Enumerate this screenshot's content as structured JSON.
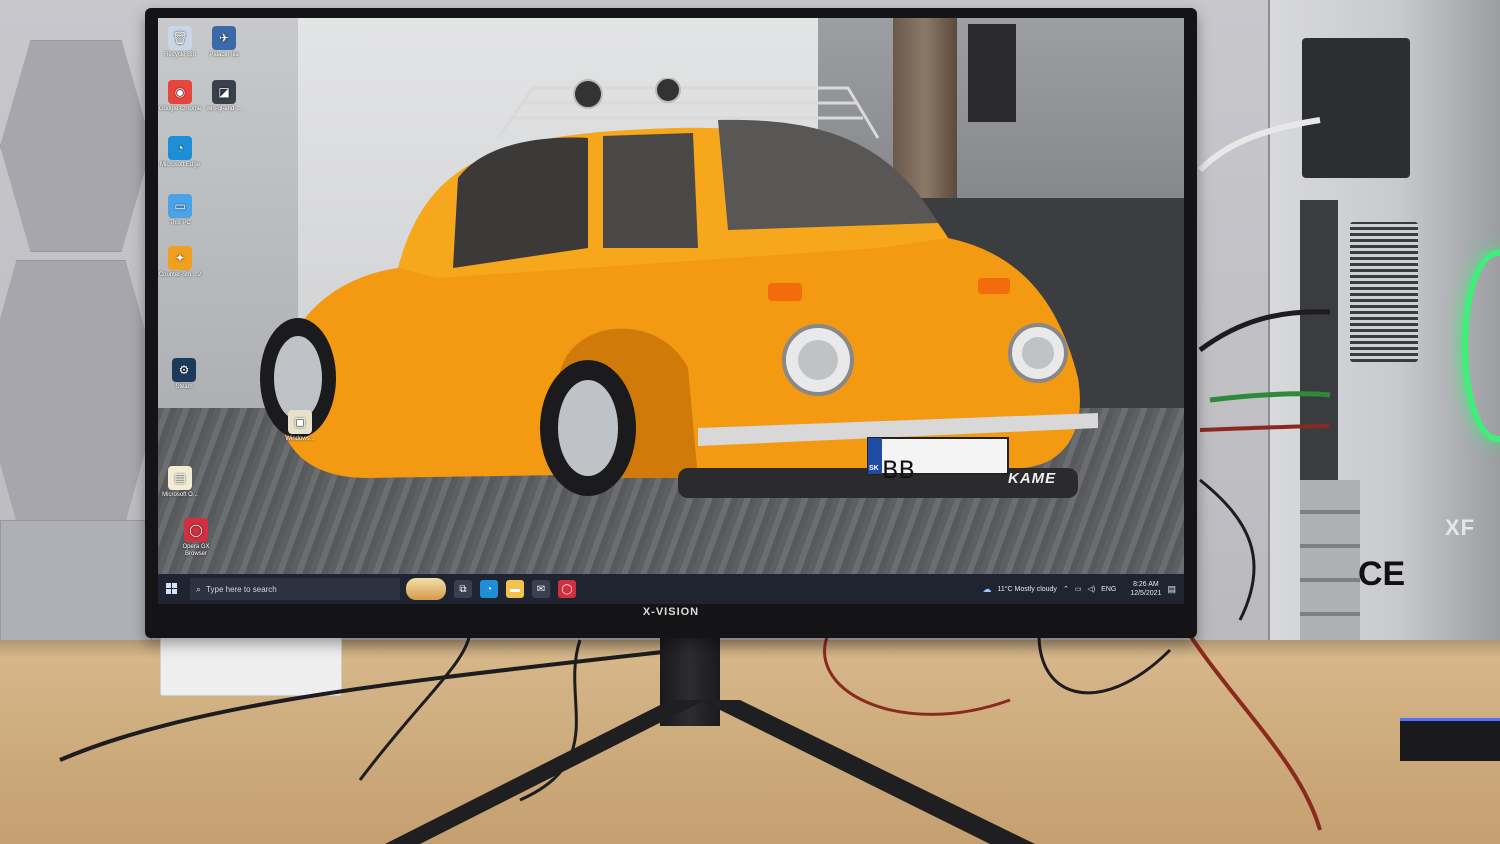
{
  "monitor": {
    "brand": "X-VISION"
  },
  "desktop": {
    "icons": [
      {
        "label": "Recycle Bin",
        "glyph": "🗑",
        "color": "#c9d6e6"
      },
      {
        "label": "Paladin Ilia",
        "glyph": "✈",
        "color": "#3b6aa8"
      },
      {
        "label": "Google Chrome",
        "glyph": "◉",
        "color": "#e8453c"
      },
      {
        "label": "win-gl-and-...",
        "glyph": "◪",
        "color": "#39404d"
      },
      {
        "label": "Microsoft Edge",
        "glyph": "◔",
        "color": "#1e8fd6"
      },
      {
        "label": "This PC",
        "glyph": "▭",
        "color": "#4aa3e8"
      },
      {
        "label": "Counter-Stri... 2",
        "glyph": "✦",
        "color": "#f0a020"
      },
      {
        "label": "Steam",
        "glyph": "⚙",
        "color": "#1b3a5c"
      },
      {
        "label": "Windows...",
        "glyph": "▣",
        "color": "#e8e2c8"
      },
      {
        "label": "Microsoft O...",
        "glyph": "▤",
        "color": "#f2ecd4"
      },
      {
        "label": "Opera GX Browser",
        "glyph": "◯",
        "color": "#d0303f"
      }
    ]
  },
  "wallpaper": {
    "plate": "BB",
    "plate_prefix": "SK",
    "brand_mark": "KAME"
  },
  "taskbar": {
    "search_placeholder": "Type here to search",
    "weather": "11°C  Mostly cloudy",
    "language": "ENG",
    "time": "8:26 AM",
    "date": "12/5/2021",
    "pinned": [
      {
        "name": "task-view",
        "glyph": "⧉",
        "color": "#3a4050"
      },
      {
        "name": "edge",
        "glyph": "◔",
        "color": "#1e8fd6"
      },
      {
        "name": "file-explorer",
        "glyph": "▬",
        "color": "#f2c14e"
      },
      {
        "name": "mail",
        "glyph": "✉",
        "color": "#3a4050"
      },
      {
        "name": "opera-gx",
        "glyph": "◯",
        "color": "#d0303f"
      }
    ]
  },
  "pc_case": {
    "label_fragment": "XF",
    "ce_mark": "CE"
  }
}
